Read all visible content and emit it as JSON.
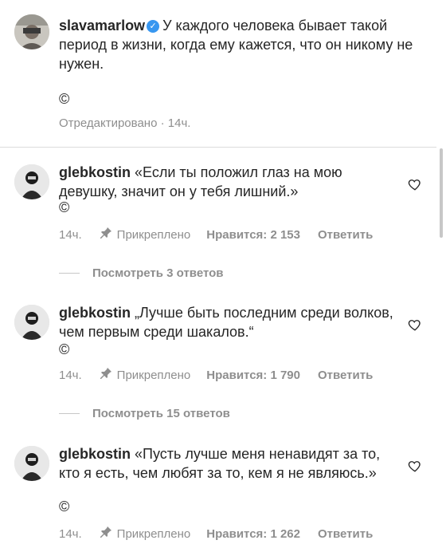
{
  "post": {
    "username": "slavamarlow",
    "verified_mark": "✓",
    "caption": "У каждого человека бывает такой период в жизни, когда ему кажется, что он никому не нужен.",
    "copyright": "©",
    "edited": "Отредактировано",
    "separator": "·",
    "time": "14ч."
  },
  "comments": [
    {
      "username": "glebkostin",
      "text": "«Если ты положил глаз на мою девушку, значит он у тебя лишний.»",
      "copyright": "©",
      "time": "14ч.",
      "pinned": "Прикреплено",
      "likes": "Нравится: 2 153",
      "reply": "Ответить",
      "view_replies": "Посмотреть 3 ответов"
    },
    {
      "username": "glebkostin",
      "text": "„Лучше быть последним среди волков, чем первым среди шакалов.“",
      "copyright": "©",
      "time": "14ч.",
      "pinned": "Прикреплено",
      "likes": "Нравится: 1 790",
      "reply": "Ответить",
      "view_replies": "Посмотреть 15 ответов"
    },
    {
      "username": "glebkostin",
      "text": "«Пусть лучше меня ненавидят за то, кто я есть, чем любят за то, кем я не являюсь.»",
      "copyright": "©",
      "time": "14ч.",
      "pinned": "Прикреплено",
      "likes": "Нравится: 1 262",
      "reply": "Ответить"
    }
  ],
  "colors": {
    "text": "#262626",
    "secondary": "#8e8e8e",
    "divider": "#dbdbdb",
    "verified": "#3897f0"
  }
}
